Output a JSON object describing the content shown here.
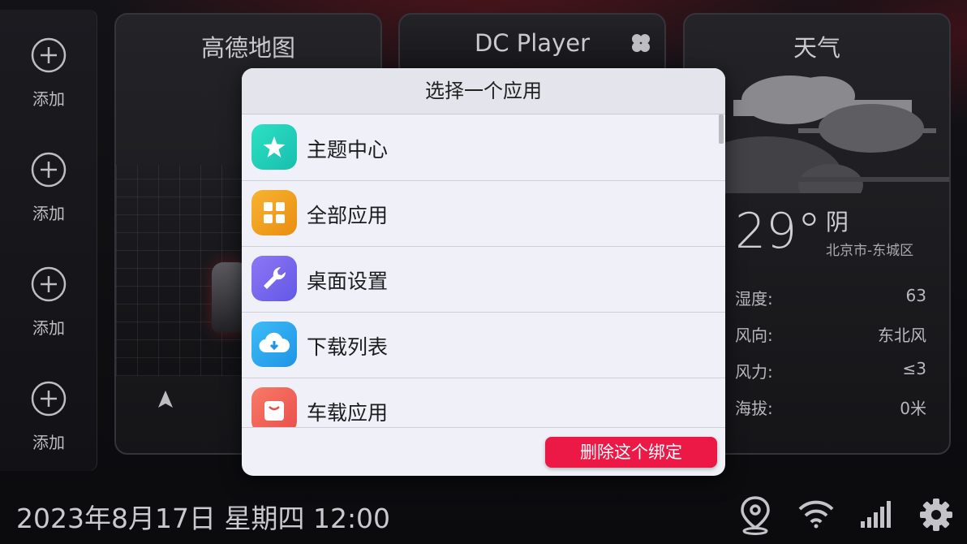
{
  "sidebar": {
    "items": [
      {
        "label": "添加"
      },
      {
        "label": "添加"
      },
      {
        "label": "添加"
      },
      {
        "label": "添加"
      }
    ]
  },
  "cards": {
    "map": {
      "title": "高德地图"
    },
    "player": {
      "title": "DC Player",
      "icon": "fan-icon"
    },
    "weather": {
      "title": "天气",
      "temperature": "29°",
      "condition": "阴",
      "city": "北京市-东城区",
      "rows": [
        {
          "key": "湿度:",
          "value": "63"
        },
        {
          "key": "风向:",
          "value": "东北风"
        },
        {
          "key": "风力:",
          "value": "≤3"
        },
        {
          "key": "海拔:",
          "value": "0米"
        }
      ]
    }
  },
  "dialog": {
    "title": "选择一个应用",
    "apps": [
      {
        "label": "主题中心",
        "icon": "star-icon",
        "color": "#1fcfb8"
      },
      {
        "label": "全部应用",
        "icon": "grid-icon",
        "color": "#f1a11c"
      },
      {
        "label": "桌面设置",
        "icon": "wrench-icon",
        "color": "#7c6cf0"
      },
      {
        "label": "下载列表",
        "icon": "cloud-download-icon",
        "color": "#2aa8ef"
      },
      {
        "label": "车载应用",
        "icon": "bag-icon",
        "color": "#f0655a"
      }
    ],
    "unbind_label": "删除这个绑定"
  },
  "statusbar": {
    "datetime": "2023年8月17日 星期四 12:00",
    "icons": [
      "location-icon",
      "wifi-icon",
      "signal-icon",
      "settings-icon"
    ]
  }
}
